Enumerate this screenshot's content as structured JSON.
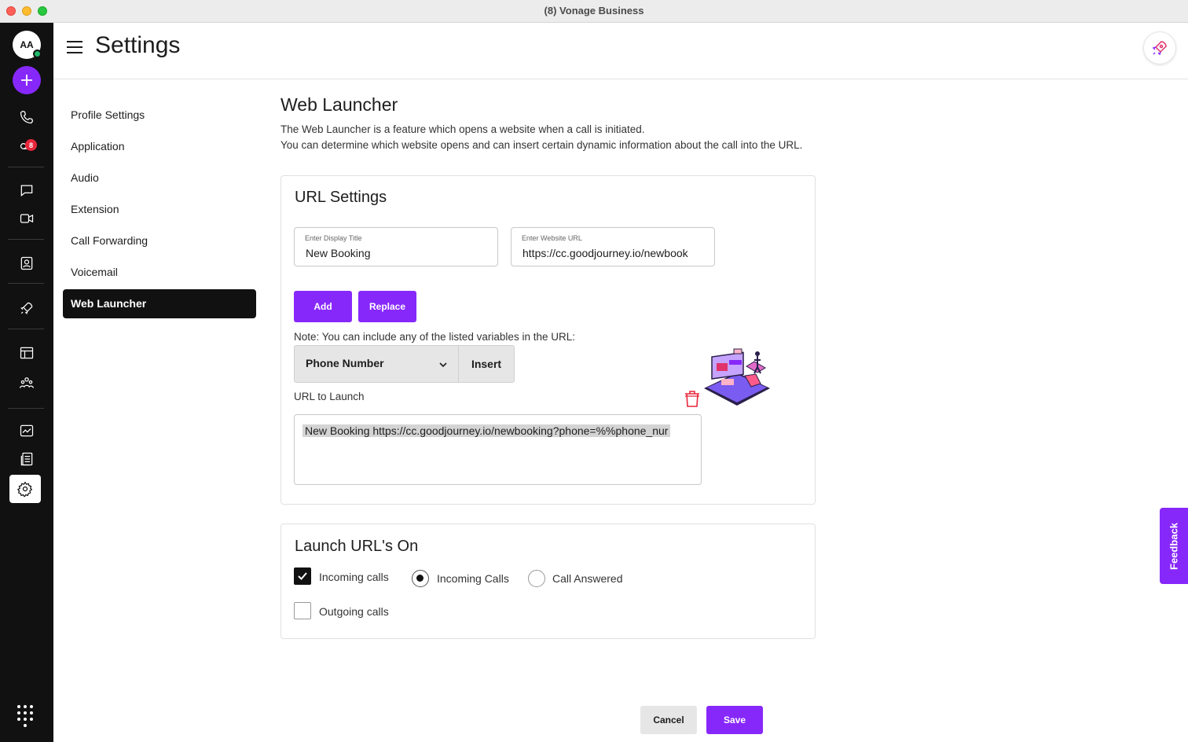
{
  "window": {
    "title": "(8) Vonage Business"
  },
  "rail": {
    "avatar_initials": "AA",
    "messages_badge": "8"
  },
  "header": {
    "title": "Settings"
  },
  "nav": {
    "items": [
      {
        "label": "Profile Settings"
      },
      {
        "label": "Application"
      },
      {
        "label": "Audio"
      },
      {
        "label": "Extension"
      },
      {
        "label": "Call Forwarding"
      },
      {
        "label": "Voicemail"
      },
      {
        "label": "Web Launcher",
        "active": true
      }
    ]
  },
  "page": {
    "title": "Web Launcher",
    "description_1": "The Web Launcher is a feature which opens a website when a call is initiated.",
    "description_2": "You can determine which website opens and can insert certain dynamic information about the call into the URL."
  },
  "url_settings": {
    "title": "URL Settings",
    "display_title_label": "Enter Display Title",
    "display_title_value": "New Booking",
    "website_url_label": "Enter Website URL",
    "website_url_value": "https://cc.goodjourney.io/newbook",
    "add_label": "Add",
    "replace_label": "Replace",
    "note": "Note: You can include any of the listed variables in the URL:",
    "variable_selected": "Phone Number",
    "insert_label": "Insert",
    "url_to_launch_label": "URL to Launch",
    "url_to_launch_value": "New Booking https://cc.goodjourney.io/newbooking?phone=%%phone_nur"
  },
  "launch_on": {
    "title": "Launch URL's On",
    "incoming_calls_label": "Incoming calls",
    "incoming_calls_checked": true,
    "outgoing_calls_label": "Outgoing calls",
    "outgoing_calls_checked": false,
    "radio_incoming_label": "Incoming Calls",
    "radio_answered_label": "Call Answered",
    "radio_selected": "Incoming Calls"
  },
  "footer": {
    "cancel_label": "Cancel",
    "save_label": "Save"
  },
  "feedback_label": "Feedback",
  "colors": {
    "accent": "#8728fb",
    "rail": "#111111",
    "badge": "#e8263c"
  },
  "icons": [
    "plus-icon",
    "phone-icon",
    "voicemail-icon",
    "chat-icon",
    "video-icon",
    "contacts-icon",
    "rocket-icon",
    "dashboard-icon",
    "team-icon",
    "analytics-icon",
    "reports-icon",
    "gear-icon",
    "keypad-icon",
    "trash-icon",
    "chevron-down-icon",
    "hamburger-icon"
  ]
}
